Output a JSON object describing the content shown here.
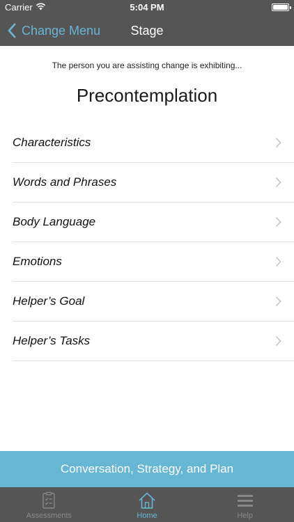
{
  "status_bar": {
    "carrier": "Carrier",
    "time": "5:04 PM"
  },
  "nav": {
    "back_label": "Change Menu",
    "title": "Stage"
  },
  "header": {
    "subtitle": "The person you are assisting change is exhibiting...",
    "stage": "Precontemplation"
  },
  "list": {
    "items": [
      {
        "label": "Characteristics"
      },
      {
        "label": "Words and Phrases"
      },
      {
        "label": "Body Language"
      },
      {
        "label": "Emotions"
      },
      {
        "label": "Helper’s Goal"
      },
      {
        "label": "Helper’s Tasks"
      }
    ]
  },
  "cta": {
    "label": "Conversation, Strategy, and Plan"
  },
  "tabbar": {
    "tabs": [
      {
        "label": "Assessments",
        "icon": "clipboard-checklist-icon",
        "active": false
      },
      {
        "label": "Home",
        "icon": "home-icon",
        "active": true
      },
      {
        "label": "Help",
        "icon": "menu-lines-icon",
        "active": false
      }
    ]
  },
  "colors": {
    "accent": "#66b6d4",
    "bar_background": "#555555"
  }
}
